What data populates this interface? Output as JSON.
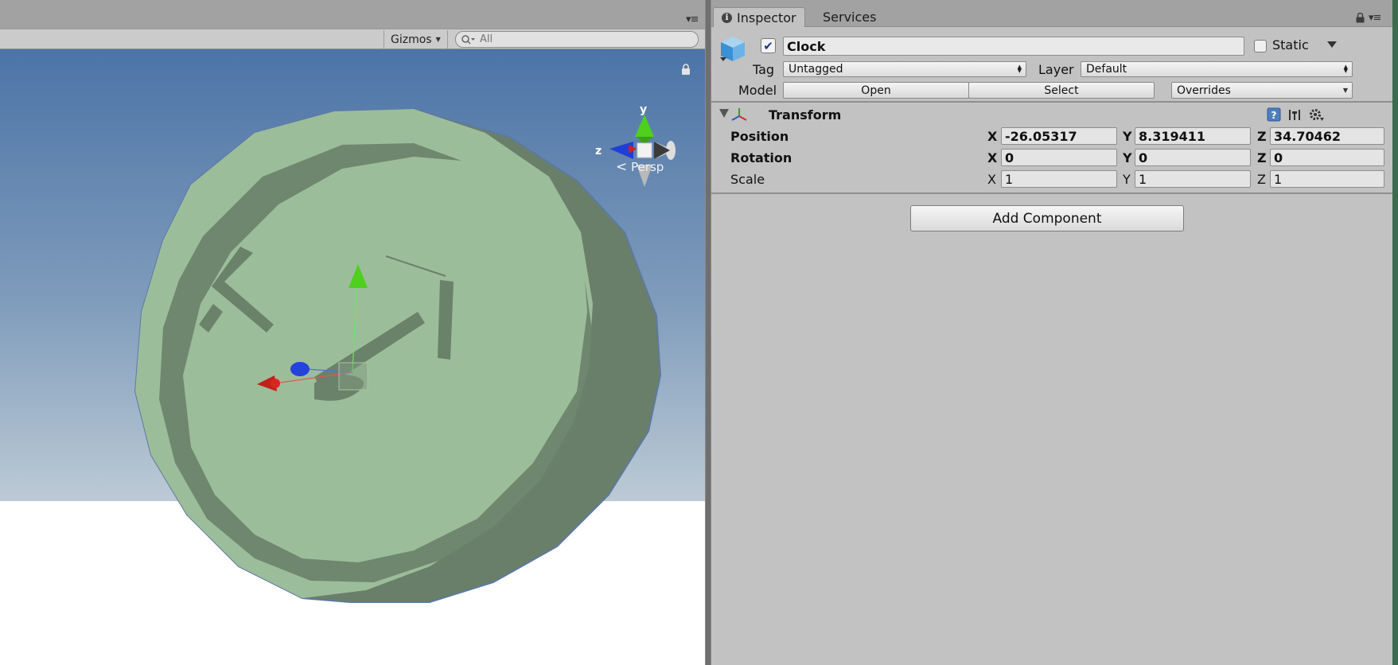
{
  "scene_view": {
    "toolbar": {
      "gizmos_label": "Gizmos",
      "search_placeholder": "All"
    },
    "orientation_gizmo": {
      "y_label": "y",
      "z_label": "z",
      "projection_label": "Persp"
    }
  },
  "inspector": {
    "tabs": [
      {
        "label": "Inspector",
        "icon": "info-icon",
        "active": true
      },
      {
        "label": "Services",
        "active": false
      }
    ],
    "game_object": {
      "name": "Clock",
      "active": true,
      "static_label": "Static",
      "static_checked": false,
      "tag_label": "Tag",
      "tag_value": "Untagged",
      "layer_label": "Layer",
      "layer_value": "Default",
      "model_label": "Model",
      "open_label": "Open",
      "select_label": "Select",
      "overrides_label": "Overrides"
    },
    "transform": {
      "title": "Transform",
      "position": {
        "label": "Position",
        "x": "-26.05317",
        "y": "8.319411",
        "z": "34.70462"
      },
      "rotation": {
        "label": "Rotation",
        "x": "0",
        "y": "0",
        "z": "0"
      },
      "scale": {
        "label": "Scale",
        "x": "1",
        "y": "1",
        "z": "1"
      },
      "axis_labels": {
        "x": "X",
        "y": "Y",
        "z": "Z"
      }
    },
    "add_component_label": "Add Component"
  },
  "colors": {
    "sky_top": "#4f77a8",
    "sky_bottom": "#b7c6d2",
    "clock_face": "#9cbd9a",
    "clock_rim": "#687f68",
    "panel_bg": "#c2c2c2",
    "axis_x": "#d0201c",
    "axis_y": "#4fcf1e",
    "axis_z": "#1f3fd8"
  }
}
